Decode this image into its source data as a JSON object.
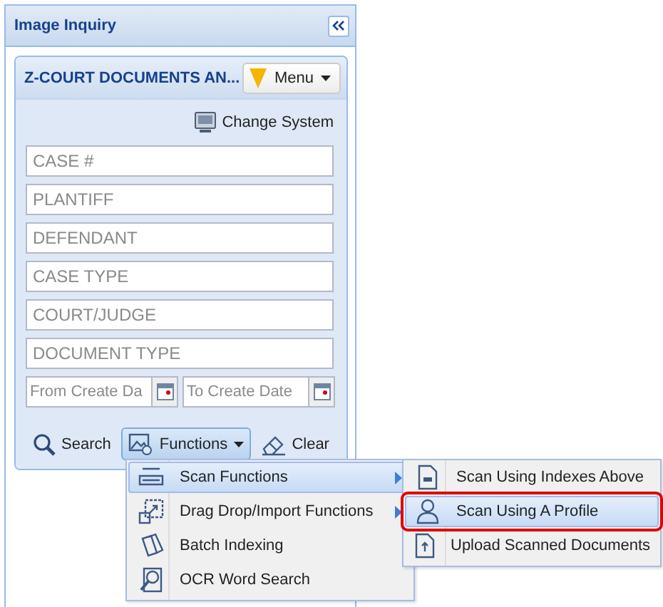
{
  "panel": {
    "title": "Image Inquiry"
  },
  "section": {
    "title": "Z-COURT DOCUMENTS AN...",
    "menu_button": "Menu"
  },
  "change_system": "Change System",
  "fields": [
    {
      "placeholder": "CASE #"
    },
    {
      "placeholder": "PLANTIFF"
    },
    {
      "placeholder": "DEFENDANT"
    },
    {
      "placeholder": "CASE TYPE"
    },
    {
      "placeholder": "COURT/JUDGE"
    },
    {
      "placeholder": "DOCUMENT TYPE"
    }
  ],
  "date_fields": [
    {
      "placeholder": "From Create Da"
    },
    {
      "placeholder": "To Create Date"
    }
  ],
  "actions": [
    {
      "label": "Search",
      "kind": "search",
      "expanded": false
    },
    {
      "label": "Functions",
      "kind": "functions",
      "expanded": true
    },
    {
      "label": "Clear",
      "kind": "clear",
      "expanded": false
    }
  ],
  "functions_menu": [
    {
      "label": "Scan Functions",
      "kind": "scanner",
      "has_submenu": true,
      "selected": true
    },
    {
      "label": "Drag Drop/Import Functions",
      "kind": "import",
      "has_submenu": true,
      "selected": false
    },
    {
      "label": "Batch Indexing",
      "kind": "pages",
      "has_submenu": false,
      "selected": false
    },
    {
      "label": "OCR Word Search",
      "kind": "ocr",
      "has_submenu": false,
      "selected": false
    }
  ],
  "scan_submenu": [
    {
      "label": "Scan Using Indexes Above",
      "kind": "document",
      "selected": false,
      "outlined": false
    },
    {
      "label": "Scan Using A Profile",
      "kind": "person",
      "selected": true,
      "outlined": true
    },
    {
      "label": "Upload Scanned Documents",
      "kind": "upload",
      "selected": false,
      "outlined": false
    }
  ]
}
